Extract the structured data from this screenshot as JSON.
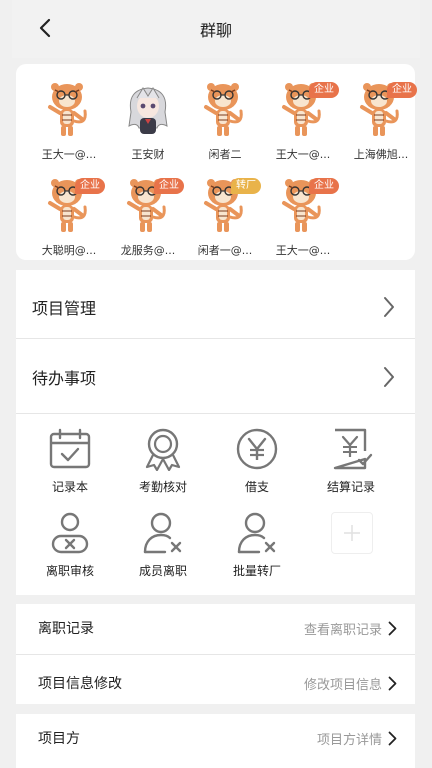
{
  "header": {
    "title": "群聊"
  },
  "members": [
    {
      "name": "王大一@...",
      "avatar": "tiger",
      "badge": ""
    },
    {
      "name": "王安财",
      "avatar": "anime-girl",
      "badge": ""
    },
    {
      "name": "闲者二",
      "avatar": "tiger",
      "badge": ""
    },
    {
      "name": "王大一@...",
      "avatar": "tiger",
      "badge": "企业"
    },
    {
      "name": "上海佛旭...",
      "avatar": "tiger",
      "badge": "企业"
    },
    {
      "name": "大聪明@...",
      "avatar": "tiger",
      "badge": "企业"
    },
    {
      "name": "龙服务@...",
      "avatar": "tiger",
      "badge": "企业"
    },
    {
      "name": "闲者一@...",
      "avatar": "tiger",
      "badge": "转厂"
    },
    {
      "name": "王大一@...",
      "avatar": "tiger",
      "badge": "企业"
    }
  ],
  "menu": {
    "project_management": "项目管理",
    "todo": "待办事项"
  },
  "tools": [
    {
      "label": "记录本",
      "icon": "calendar-check-icon"
    },
    {
      "label": "考勤核对",
      "icon": "award-medal-icon"
    },
    {
      "label": "借支",
      "icon": "yen-circle-icon"
    },
    {
      "label": "结算记录",
      "icon": "yen-document-icon"
    },
    {
      "label": "离职审核",
      "icon": "user-reject-icon"
    },
    {
      "label": "成员离职",
      "icon": "user-remove-icon"
    },
    {
      "label": "批量转厂",
      "icon": "user-transfer-icon"
    }
  ],
  "info_rows": [
    {
      "label": "离职记录",
      "action": "查看离职记录"
    },
    {
      "label": "项目信息修改",
      "action": "修改项目信息"
    }
  ],
  "project_row": {
    "label": "项目方",
    "action": "项目方详情"
  },
  "colors": {
    "accent": "#e8734a",
    "badge_factory": "#e9b34a",
    "icon_gray": "#777777"
  }
}
